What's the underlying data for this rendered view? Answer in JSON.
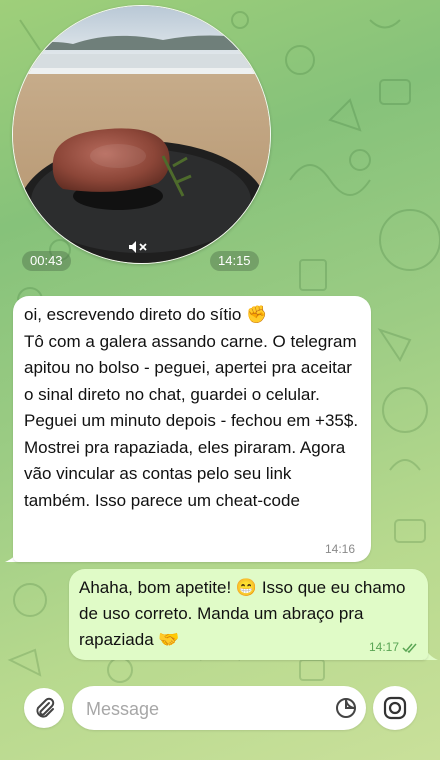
{
  "video_message": {
    "duration": "00:43",
    "time": "14:15",
    "muted": true
  },
  "incoming_message": {
    "text_part1": "oi, escrevendo direto do sítio",
    "emoji1": "✊",
    "text_part2": "Tô com a galera assando carne. O telegram apitou no bolso - peguei, apertei pra aceitar o sinal direto no chat, guardei o celular.\nPeguei um minuto depois - fechou em +35$. Mostrei pra rapaziada, eles piraram. Agora vão vincular as contas pelo seu link também. Isso parece um cheat-code",
    "time": "14:16"
  },
  "outgoing_message": {
    "text_part1": "Ahaha, bom apetite!",
    "emoji1": "😁",
    "text_part2": "Isso que eu chamo de uso correto. Manda um abraço pra rapaziada",
    "emoji2": "🤝",
    "time": "14:17",
    "status": "read"
  },
  "input_bar": {
    "placeholder": "Message"
  },
  "colors": {
    "outgoing_bubble": "#e0fbc7",
    "incoming_bubble": "#ffffff",
    "accent_green": "#5aa554",
    "wallpaper": "#9ccc84"
  }
}
